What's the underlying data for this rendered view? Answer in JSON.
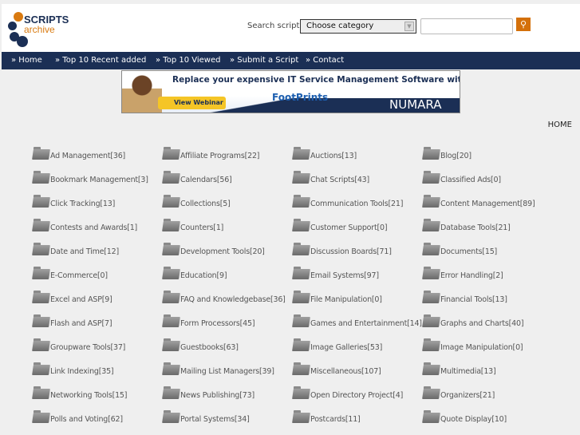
{
  "logo": {
    "line1": "SCRIPTS",
    "line2": "archive"
  },
  "search": {
    "label": "Search script:",
    "category_selected": "Choose category",
    "query": ""
  },
  "nav": [
    "» Home",
    "» Top 10 Recent added",
    "» Top 10 Viewed",
    "» Submit a Script",
    "» Contact"
  ],
  "ad": {
    "headline": "Replace your expensive IT Service Management Software with",
    "button": "View Webinar",
    "product": "FootPrints",
    "brand": "NUMARA"
  },
  "breadcrumb": "HOME",
  "categories": [
    "Ad Management[36]",
    "Affiliate Programs[22]",
    "Auctions[13]",
    "Blog[20]",
    "Bookmark Management[3]",
    "Calendars[56]",
    "Chat Scripts[43]",
    "Classified Ads[0]",
    "Click Tracking[13]",
    "Collections[5]",
    "Communication Tools[21]",
    "Content Management[89]",
    "Contests and Awards[1]",
    "Counters[1]",
    "Customer Support[0]",
    "Database Tools[21]",
    "Date and Time[12]",
    "Development Tools[20]",
    "Discussion Boards[71]",
    "Documents[15]",
    "E-Commerce[0]",
    "Education[9]",
    "Email Systems[97]",
    "Error Handling[2]",
    "Excel and ASP[9]",
    "FAQ and Knowledgebase[36]",
    "File Manipulation[0]",
    "Financial Tools[13]",
    "Flash and ASP[7]",
    "Form Processors[45]",
    "Games and Entertainment[14]",
    "Graphs and Charts[40]",
    "Groupware Tools[37]",
    "Guestbooks[63]",
    "Image Galleries[53]",
    "Image Manipulation[0]",
    "Link Indexing[35]",
    "Mailing List Managers[39]",
    "Miscellaneous[107]",
    "Multimedia[13]",
    "Networking Tools[15]",
    "News Publishing[73]",
    "Open Directory Project[4]",
    "Organizers[21]",
    "Polls and Voting[62]",
    "Portal Systems[34]",
    "Postcards[11]",
    "Quote Display[10]"
  ]
}
